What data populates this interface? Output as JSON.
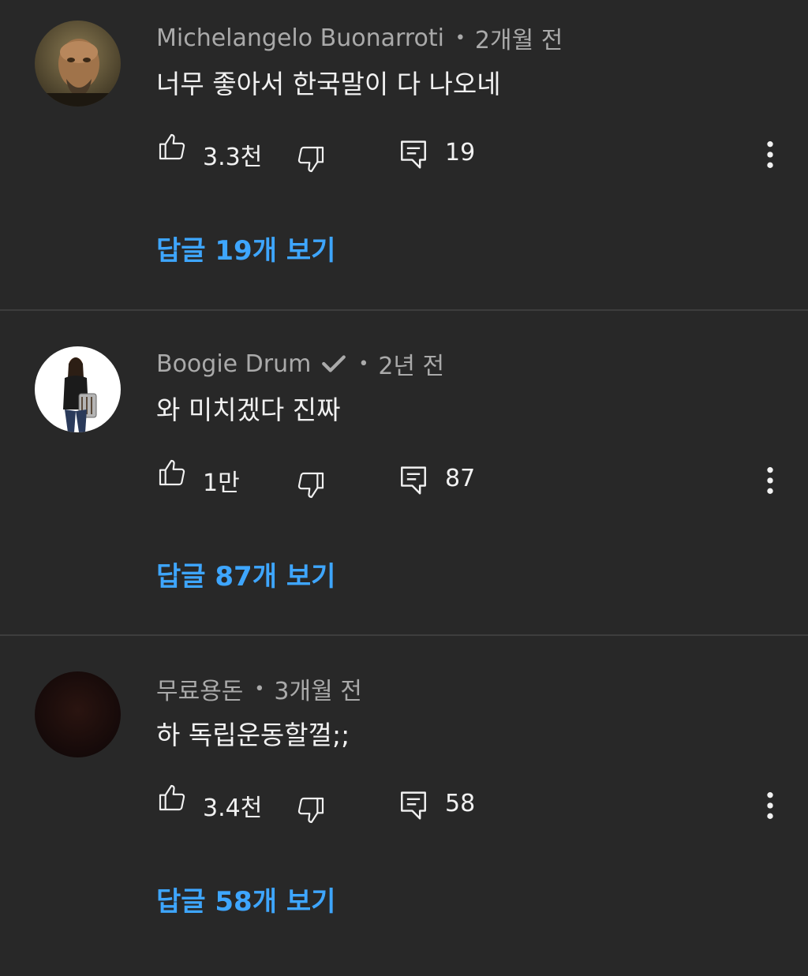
{
  "comments": [
    {
      "author": "Michelangelo Buonarroti",
      "verified": false,
      "time": "2개월 전",
      "text": "너무 좋아서 한국말이 다 나오네",
      "likes": "3.3천",
      "replies": "19",
      "view_replies": "답글 19개 보기"
    },
    {
      "author": "Boogie Drum",
      "verified": true,
      "time": "2년 전",
      "text": "와 미치겠다 진짜",
      "likes": "1만",
      "replies": "87",
      "view_replies": "답글 87개 보기"
    },
    {
      "author": "무료용돈",
      "verified": false,
      "time": "3개월 전",
      "text": "하 독립운동할껄;;",
      "likes": "3.4천",
      "replies": "58",
      "view_replies": "답글 58개 보기"
    }
  ],
  "separator": "•",
  "colors": {
    "background": "#282828",
    "meta_text": "#aaaaaa",
    "body_text": "#f1f1f1",
    "link": "#3ea6ff",
    "divider": "#3d3d3d"
  },
  "icons": [
    "thumbs-up-icon",
    "thumbs-down-icon",
    "reply-icon",
    "more-vertical-icon",
    "verified-check-icon"
  ]
}
